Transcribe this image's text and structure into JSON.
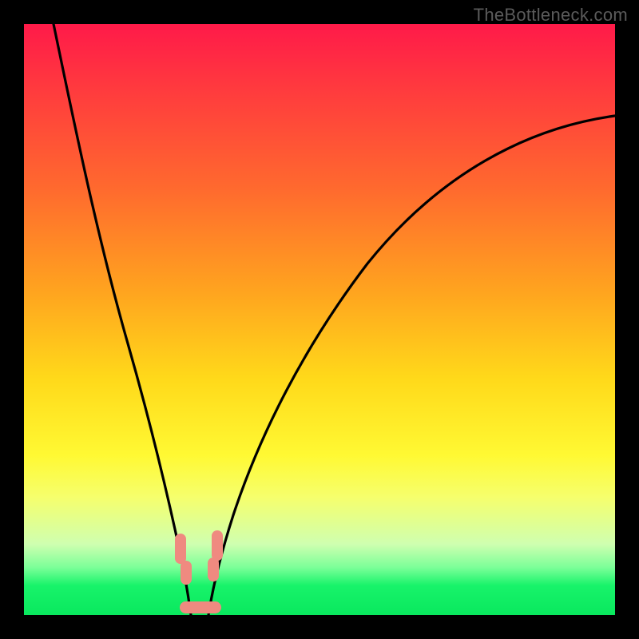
{
  "watermark": "TheBottleneck.com",
  "chart_data": {
    "type": "line",
    "title": "",
    "xlabel": "",
    "ylabel": "",
    "xlim": [
      0,
      100
    ],
    "ylim": [
      0,
      100
    ],
    "grid": false,
    "legend": false,
    "series": [
      {
        "name": "left-curve",
        "x": [
          5,
          8,
          11,
          14,
          17,
          20,
          22,
          24,
          25.5,
          26.5,
          27.3,
          28
        ],
        "y": [
          100,
          85,
          70,
          56,
          43,
          31,
          22,
          14,
          9,
          5,
          2,
          0
        ]
      },
      {
        "name": "right-curve",
        "x": [
          31,
          32,
          34,
          37,
          41,
          47,
          55,
          65,
          78,
          92,
          100
        ],
        "y": [
          0,
          3,
          8,
          16,
          26,
          38,
          50,
          61,
          72,
          80,
          84
        ]
      }
    ],
    "valley_markers": [
      {
        "side": "left",
        "y_range": [
          8,
          14
        ]
      },
      {
        "side": "right",
        "y_range": [
          8,
          14
        ]
      },
      {
        "side": "bottom",
        "x_range": [
          27,
          32
        ]
      }
    ],
    "background_gradient": {
      "top": "#ff1a49",
      "mid": "#fff933",
      "bottom": "#09e85e"
    }
  }
}
